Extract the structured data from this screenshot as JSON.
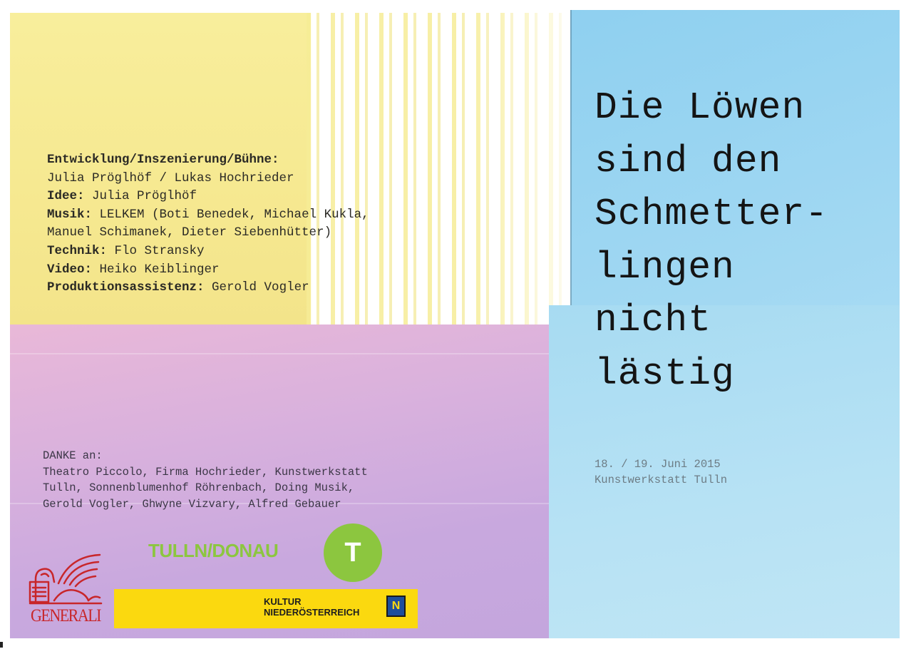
{
  "credits": {
    "line1_label": "Entwicklung/Inszenierung/Bühne:",
    "line2": "Julia Pröglhöf / Lukas Hochrieder",
    "idee_label": "Idee:",
    "idee_value": " Julia Pröglhöf",
    "musik_label": "Musik:",
    "musik_value": " LELKEM (Boti Benedek, Michael Kukla,",
    "musik_value_cont": "Manuel Schimanek, Dieter Siebenhütter)",
    "technik_label": "Technik:",
    "technik_value": " Flo Stransky",
    "video_label": "Video:",
    "video_value": " Heiko Keiblinger",
    "produktion_label": "Produktionsassistenz:",
    "produktion_value": " Gerold Vogler"
  },
  "title_lines": [
    "Die Löwen",
    "sind den",
    "Schmetter-",
    "lingen",
    "nicht",
    "lästig"
  ],
  "event": {
    "date": "18. / 19. Juni 2015",
    "venue": "Kunstwerkstatt Tulln"
  },
  "thanks": {
    "heading": "DANKE an:",
    "lines": [
      "Theatro Piccolo, Firma Hochrieder, Kunstwerkstatt",
      "Tulln, Sonnenblumenhof Röhrenbach, Doing Musik,",
      "Gerold Vogler, Ghwyne Vizvary, Alfred Gebauer"
    ]
  },
  "logos": {
    "generali": "GENERALI",
    "tulln": "TULLN/DONAU",
    "tulln_badge": "T",
    "kultur_line1": "KULTUR",
    "kultur_line2": "NIEDERÖSTERREICH",
    "noe_badge": "N"
  },
  "colors": {
    "yellow_paper": "#f6e991",
    "purple_paper": "#d2aede",
    "blue_paper": "#98d4f1",
    "tulln_green": "#8cc63f",
    "generali_red": "#c8262a",
    "kultur_yellow": "#fbd90f",
    "noe_blue": "#1d4e9b"
  }
}
